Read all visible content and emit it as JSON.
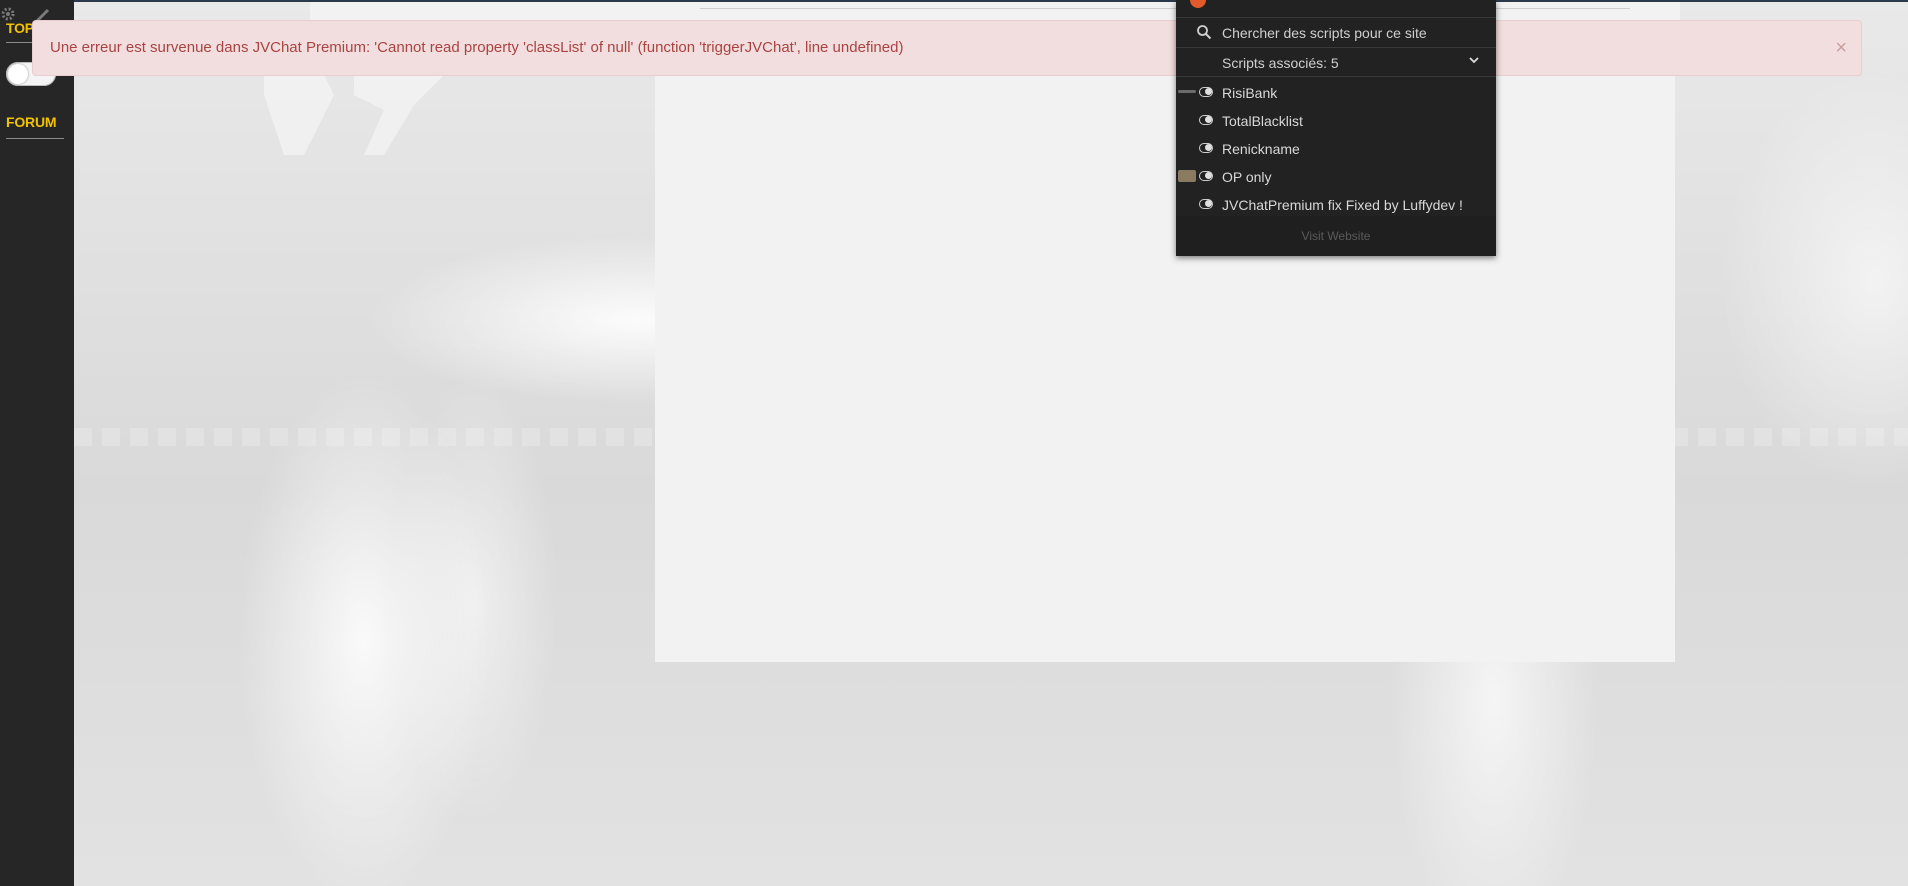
{
  "sidebar": {
    "title": "TOPI",
    "forum_label": "FORUM",
    "toggle_on": false
  },
  "alert": {
    "message": "Une erreur est survenue dans JVChat Premium: 'Cannot read property 'classList' of null' (function 'triggerJVChat', line undefined)",
    "close_symbol": "×"
  },
  "popup": {
    "search_placeholder": "Chercher des scripts pour ce site",
    "associated_label": "Scripts associés: 5",
    "scripts": [
      {
        "name": "RisiBank",
        "enabled": true
      },
      {
        "name": "TotalBlacklist",
        "enabled": true
      },
      {
        "name": "Renickname",
        "enabled": true
      },
      {
        "name": "OP only",
        "enabled": true
      },
      {
        "name": "JVChatPremium fix Fixed by Luffydev !",
        "enabled": true
      }
    ],
    "footer_link": "Visit Website"
  },
  "colors": {
    "sidebar_bg": "#262626",
    "accent_yellow": "#f2c200",
    "alert_text": "#a94442",
    "alert_bg": "#f2dede",
    "popup_bg": "#222222"
  }
}
